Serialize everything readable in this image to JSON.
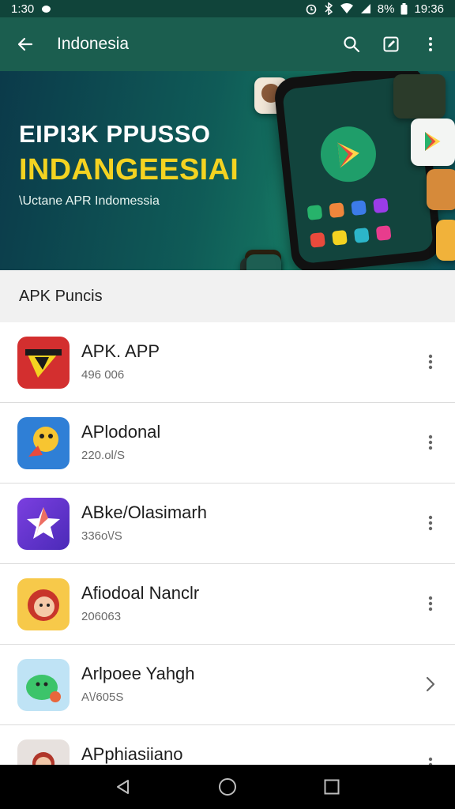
{
  "status_bar": {
    "time_left": "1:30",
    "battery": "8%",
    "time_right": "19:36"
  },
  "app_bar": {
    "title": "Indonesia",
    "back_icon": "arrow-left-icon",
    "actions": [
      "search-icon",
      "edit-icon",
      "more-vertical-icon"
    ]
  },
  "banner": {
    "line1": "EIPI3K PPUSSO",
    "line2": "INDANGEESIAI",
    "line3": "\\Uctane APR Indomessia"
  },
  "section": {
    "title": "APK Puncis"
  },
  "apps": [
    {
      "name": "APK. APP",
      "sub": "496 006",
      "action_icon": "more-vertical-icon"
    },
    {
      "name": "APlodonal",
      "sub": "220.ol/S",
      "action_icon": "more-vertical-icon"
    },
    {
      "name": "ABke/Olasimarh",
      "sub": "336o\\/S",
      "action_icon": "more-vertical-icon"
    },
    {
      "name": "Afiodoal Nanclr",
      "sub": "206063",
      "action_icon": "more-vertical-icon"
    },
    {
      "name": "Arlpoee Yahgh",
      "sub": "A\\/605S",
      "action_icon": "chevron-right-icon"
    },
    {
      "name": "APphiasiiano",
      "sub": "",
      "action_icon": "more-vertical-icon"
    }
  ],
  "colors": {
    "status_bar": "#10443a",
    "app_bar": "#1b5e4f",
    "banner_accent": "#f4d321"
  },
  "nav_bar": [
    "back-triangle-icon",
    "home-circle-icon",
    "recents-square-icon"
  ]
}
